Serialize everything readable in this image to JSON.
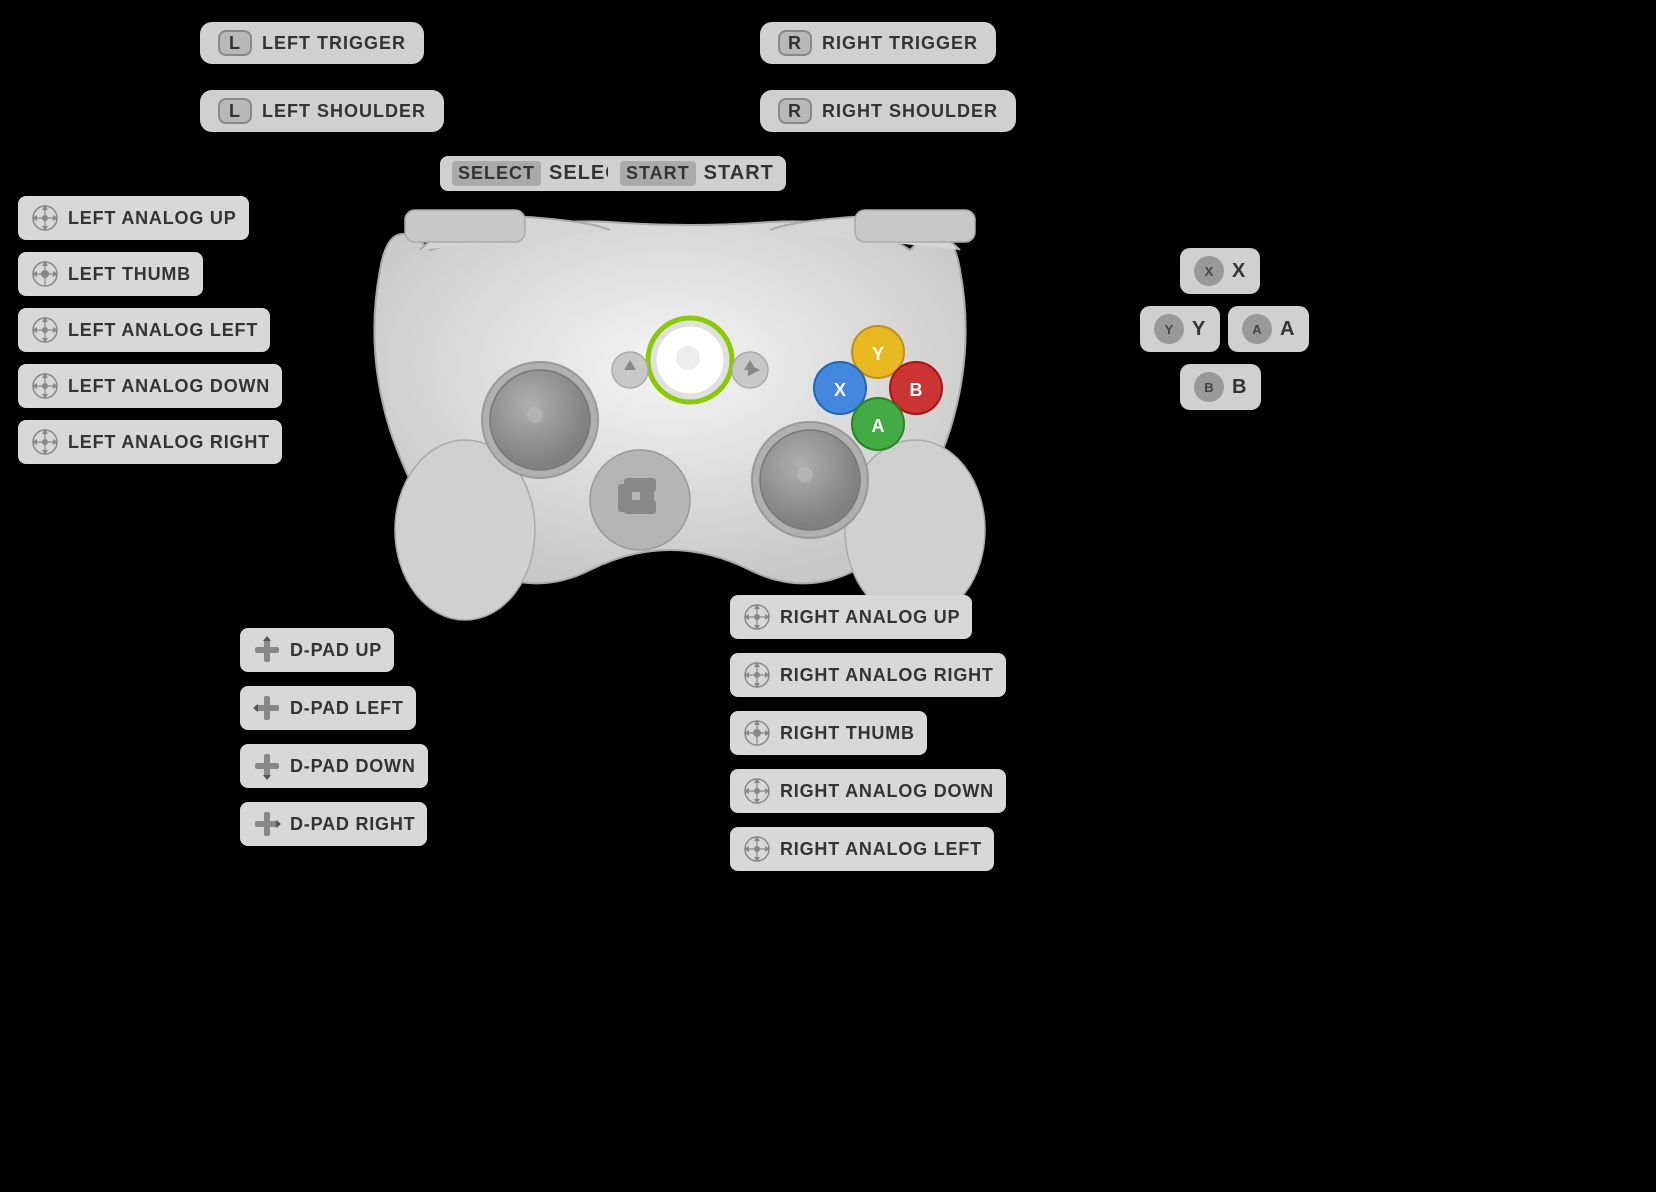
{
  "labels": {
    "left_trigger": "LEFT TRIGGER",
    "left_shoulder": "LEFT SHOULDER",
    "right_trigger": "RIGHT TRIGGER",
    "right_shoulder": "RIGHT SHOULDER",
    "select": "SELECT",
    "start": "START",
    "left_analog_up": "LEFT ANALOG UP",
    "left_thumb": "LEFT THUMB",
    "left_analog_left": "LEFT ANALOG LEFT",
    "left_analog_down": "LEFT ANALOG DOWN",
    "left_analog_right": "LEFT ANALOG RIGHT",
    "right_analog_up": "RIGHT ANALOG UP",
    "right_analog_right": "RIGHT ANALOG RIGHT",
    "right_thumb": "RIGHT THUMB",
    "right_analog_down": "RIGHT ANALOG DOWN",
    "right_analog_left": "RIGHT ANALOG LEFT",
    "dpad_up": "D-PAD UP",
    "dpad_left": "D-PAD LEFT",
    "dpad_down": "D-PAD DOWN",
    "dpad_right": "D-PAD RIGHT",
    "x": "X",
    "y": "Y",
    "a": "A",
    "b": "B",
    "l": "L",
    "r": "R",
    "select_badge": "SELECT",
    "start_badge": "START"
  },
  "colors": {
    "bg": "#000000",
    "label_bg": "#d0d0d0",
    "controller_body": "#e0e0e0",
    "button_yellow": "#e8b820",
    "button_blue": "#4488dd",
    "button_red": "#cc3333",
    "button_green": "#44aa44",
    "accent_green": "#88cc00"
  }
}
